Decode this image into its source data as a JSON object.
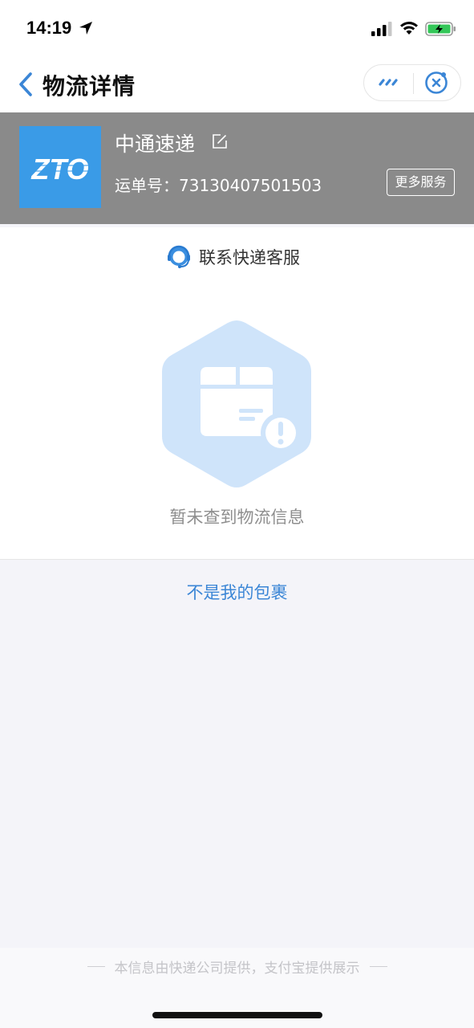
{
  "status_bar": {
    "time": "14:19"
  },
  "nav": {
    "title": "物流详情"
  },
  "company": {
    "name": "中通速递",
    "logo_text": "ZTO",
    "tracking_label": "运单号：",
    "tracking_number": "73130407501503",
    "more_services_label": "更多服务"
  },
  "main": {
    "contact_label": "联系快递客服",
    "empty_text": "暂未查到物流信息"
  },
  "actions": {
    "not_my_package_label": "不是我的包裹"
  },
  "footer": {
    "note": "本信息由快递公司提供，支付宝提供展示"
  },
  "colors": {
    "accent": "#3b86d6",
    "header_bg": "#8a8a8a",
    "logo_bg": "#3a9be7",
    "page_bg": "#f4f4f9"
  }
}
